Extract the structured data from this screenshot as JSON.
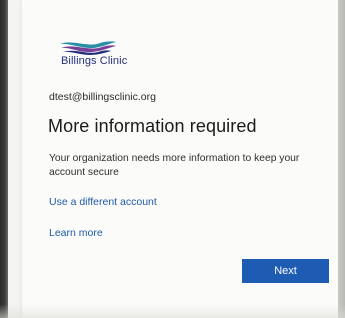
{
  "brand": {
    "logo_text": "Billings Clinic",
    "logo_icon": "swoosh-icon",
    "colors": {
      "navy": "#23307a",
      "purple": "#7a3f97",
      "teal": "#2a8fa6"
    }
  },
  "account": {
    "email": "dtest@billingsclinic.org"
  },
  "main": {
    "title": "More information required",
    "description": "Your organization needs more information to keep your account secure",
    "use_different_account": "Use a different account",
    "learn_more": "Learn more"
  },
  "actions": {
    "next_label": "Next",
    "accent": "#1e5cb3"
  }
}
